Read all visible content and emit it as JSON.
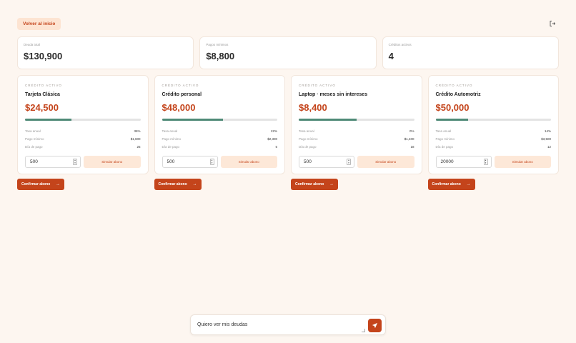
{
  "header": {
    "back_label": "Volver al inicio",
    "logout_icon": "logout-icon"
  },
  "stats": [
    {
      "label": "Deuda total",
      "value": "$130,900"
    },
    {
      "label": "Pagos mínimos",
      "value": "$8,800"
    },
    {
      "label": "Créditos activos",
      "value": "4"
    }
  ],
  "cards": [
    {
      "eyebrow": "Crédito activo",
      "name": "Tarjeta Clásica",
      "amount": "$24,500",
      "progress": 0.4,
      "rows": [
        {
          "label": "Tasa anual",
          "value": "36%"
        },
        {
          "label": "Pago mínimo",
          "value": "$1,600"
        },
        {
          "label": "Día de pago",
          "value": "25"
        }
      ],
      "input_value": "500",
      "simulate_label": "Simular abono",
      "confirm_label": "Confirmar abono"
    },
    {
      "eyebrow": "Crédito activo",
      "name": "Crédito personal",
      "amount": "$48,000",
      "progress": 0.53,
      "rows": [
        {
          "label": "Tasa anual",
          "value": "22%"
        },
        {
          "label": "Pago mínimo",
          "value": "$2,300"
        },
        {
          "label": "Día de pago",
          "value": "5"
        }
      ],
      "input_value": "500",
      "simulate_label": "Simular abono",
      "confirm_label": "Confirmar abono"
    },
    {
      "eyebrow": "Crédito activo",
      "name": "Laptop · meses sin intereses",
      "amount": "$8,400",
      "progress": 0.5,
      "rows": [
        {
          "label": "Tasa anual",
          "value": "0%"
        },
        {
          "label": "Pago mínimo",
          "value": "$1,400"
        },
        {
          "label": "Día de pago",
          "value": "18"
        }
      ],
      "input_value": "500",
      "simulate_label": "Simular abono",
      "confirm_label": "Confirmar abono"
    },
    {
      "eyebrow": "Crédito activo",
      "name": "Crédito Automotriz",
      "amount": "$50,000",
      "progress": 0.28,
      "rows": [
        {
          "label": "Tasa anual",
          "value": "14%"
        },
        {
          "label": "Pago mínimo",
          "value": "$3,500"
        },
        {
          "label": "Día de pago",
          "value": "12"
        }
      ],
      "input_value": "20000",
      "simulate_label": "Simular abono",
      "confirm_label": "Confirmar abono"
    }
  ],
  "chat": {
    "value": "Quiero ver mis deudas",
    "send_icon": "send-icon"
  },
  "colors": {
    "accent": "#c4441b",
    "progress": "#4f8a77",
    "background": "#fdf6f0"
  }
}
